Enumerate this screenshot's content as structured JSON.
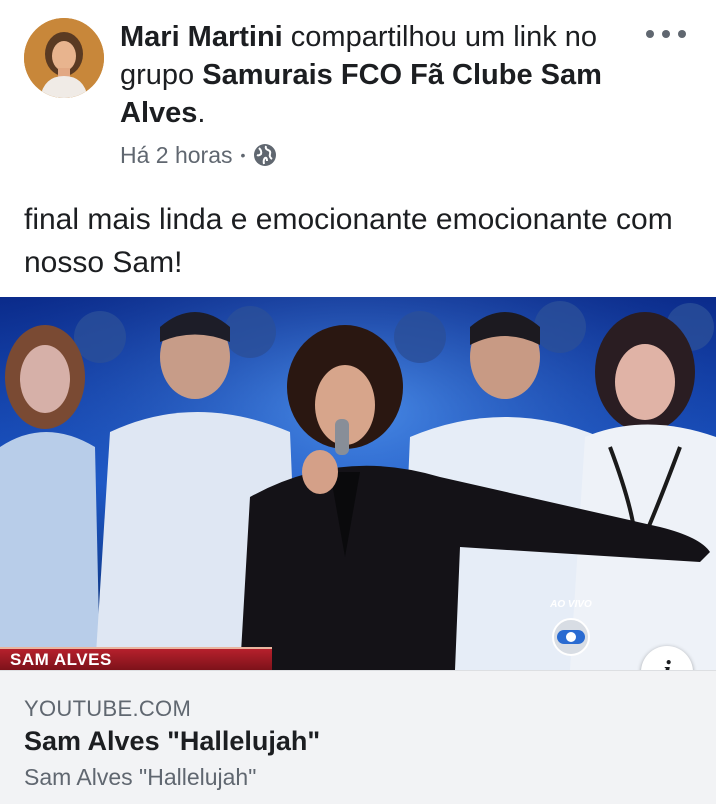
{
  "post": {
    "author": "Mari Martini",
    "action": " compartilhou um link no grupo ",
    "group": "Samurais FCO Fã Clube Sam Alves",
    "period": ".",
    "time": "Há 2 horas",
    "privacy_icon": "globe-icon",
    "more_icon": "more-options-icon",
    "text": "final mais linda e emocionante emocionante com nosso Sam!"
  },
  "media": {
    "lower_third": "SAM ALVES",
    "live_label": "AO VIVO",
    "broadcaster_logo": "globo-logo-icon",
    "info_icon": "info-icon",
    "info_label": "i"
  },
  "link": {
    "domain": "YOUTUBE.COM",
    "title": "Sam Alves \"Hallelujah\"",
    "description": "Sam Alves \"Hallelujah\""
  },
  "colors": {
    "text_primary": "#1c1e21",
    "text_secondary": "#606770",
    "card_background": "#f2f3f5",
    "stage_blue": "#1b4fb0"
  }
}
